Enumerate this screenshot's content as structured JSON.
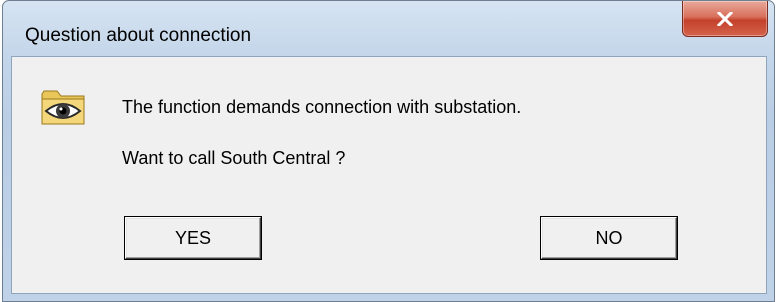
{
  "window": {
    "title": "Question about connection",
    "close_icon": "close-x-icon"
  },
  "dialog": {
    "icon": "eye-folder-icon",
    "message_line1": "The function demands connection with substation.",
    "message_line2": "Want to call South Central ?"
  },
  "buttons": {
    "yes_label": "YES",
    "no_label": "NO"
  },
  "colors": {
    "close_button": "#c4422b",
    "title_bar": "#bfd2e8",
    "client_background": "#f0f0f0"
  }
}
